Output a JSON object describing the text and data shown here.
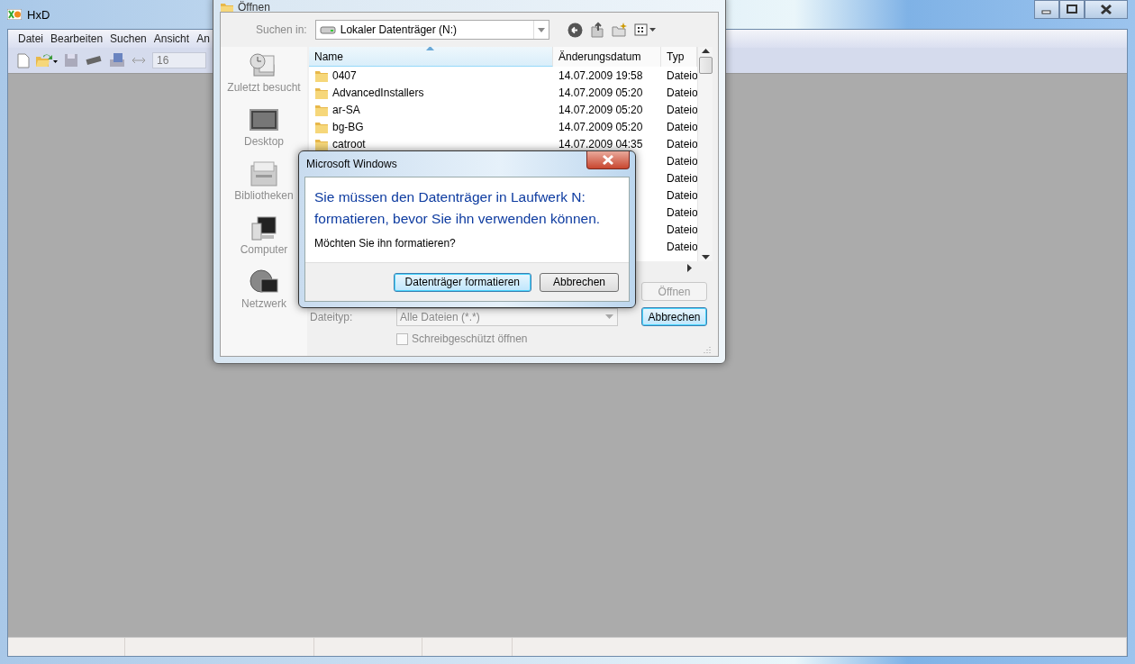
{
  "main_window": {
    "title": "HxD",
    "menu": [
      {
        "label": "Datei"
      },
      {
        "label": "Bearbeiten"
      },
      {
        "label": "Suchen"
      },
      {
        "label": "Ansicht"
      },
      {
        "label": "An"
      }
    ],
    "toolbar": {
      "bytes_per_row": "16"
    }
  },
  "open_dialog": {
    "title": "Öffnen",
    "look_in_label": "Suchen in:",
    "look_in_value": "Lokaler Datenträger (N:)",
    "places": [
      {
        "label": "Zuletzt besucht",
        "kind": "recent"
      },
      {
        "label": "Desktop",
        "kind": "desktop"
      },
      {
        "label": "Bibliotheken",
        "kind": "libraries"
      },
      {
        "label": "Computer",
        "kind": "computer"
      },
      {
        "label": "Netzwerk",
        "kind": "network"
      }
    ],
    "columns": [
      {
        "label": "Name",
        "sorted": true
      },
      {
        "label": "Änderungsdatum",
        "sorted": false
      },
      {
        "label": "Typ",
        "sorted": false
      }
    ],
    "rows": [
      {
        "name": "0407",
        "date": "14.07.2009 19:58",
        "type": "Dateio"
      },
      {
        "name": "AdvancedInstallers",
        "date": "14.07.2009 05:20",
        "type": "Dateio"
      },
      {
        "name": "ar-SA",
        "date": "14.07.2009 05:20",
        "type": "Dateio"
      },
      {
        "name": "bg-BG",
        "date": "14.07.2009 05:20",
        "type": "Dateio"
      },
      {
        "name": "catroot",
        "date": "14.07.2009 04:35",
        "type": "Dateio"
      },
      {
        "type": "Dateio"
      },
      {
        "type": "Dateio"
      },
      {
        "type": "Dateio"
      },
      {
        "type": "Dateio"
      },
      {
        "type": "Dateio"
      },
      {
        "type": "Dateio"
      }
    ],
    "file_type_label": "Dateityp:",
    "file_type_value": "Alle Dateien (*.*)",
    "read_only": {
      "label": "Schreibgeschützt öffnen",
      "checked": false
    },
    "buttons": [
      {
        "label": "Öffnen",
        "disabled": true,
        "default": false
      },
      {
        "label": "Abbrechen",
        "disabled": false,
        "default": true
      }
    ]
  },
  "message_box": {
    "title": "Microsoft Windows",
    "instruction": "Sie müssen den Datenträger in Laufwerk N: formatieren, bevor Sie ihn verwenden können.",
    "question": "Möchten Sie ihn formatieren?",
    "buttons": [
      {
        "label": "Datenträger formatieren",
        "default": true
      },
      {
        "label": "Abbrechen",
        "default": false
      }
    ]
  }
}
